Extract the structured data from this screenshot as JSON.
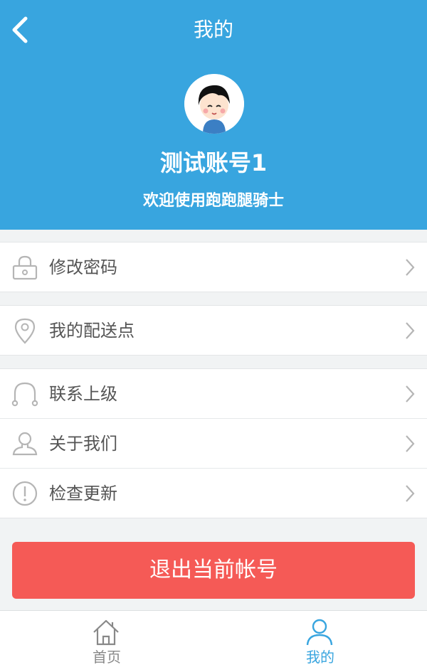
{
  "header": {
    "title": "我的",
    "user_name": "测试账号1",
    "welcome": "欢迎使用跑跑腿骑士",
    "background": "#38a5df"
  },
  "menu": {
    "group1": [
      {
        "label": "修改密码",
        "icon": "lock-icon"
      }
    ],
    "group2": [
      {
        "label": "我的配送点",
        "icon": "location-pin-icon"
      }
    ],
    "group3": [
      {
        "label": "联系上级",
        "icon": "headset-icon"
      },
      {
        "label": "关于我们",
        "icon": "person-icon"
      },
      {
        "label": "检查更新",
        "icon": "exclamation-circle-icon"
      }
    ]
  },
  "logout": {
    "label": "退出当前帐号",
    "color": "#f55a56"
  },
  "tabbar": {
    "tabs": [
      {
        "label": "首页",
        "icon": "home-icon",
        "active": false
      },
      {
        "label": "我的",
        "icon": "user-icon",
        "active": true
      }
    ],
    "active_color": "#38a5df",
    "inactive_color": "#888888"
  }
}
